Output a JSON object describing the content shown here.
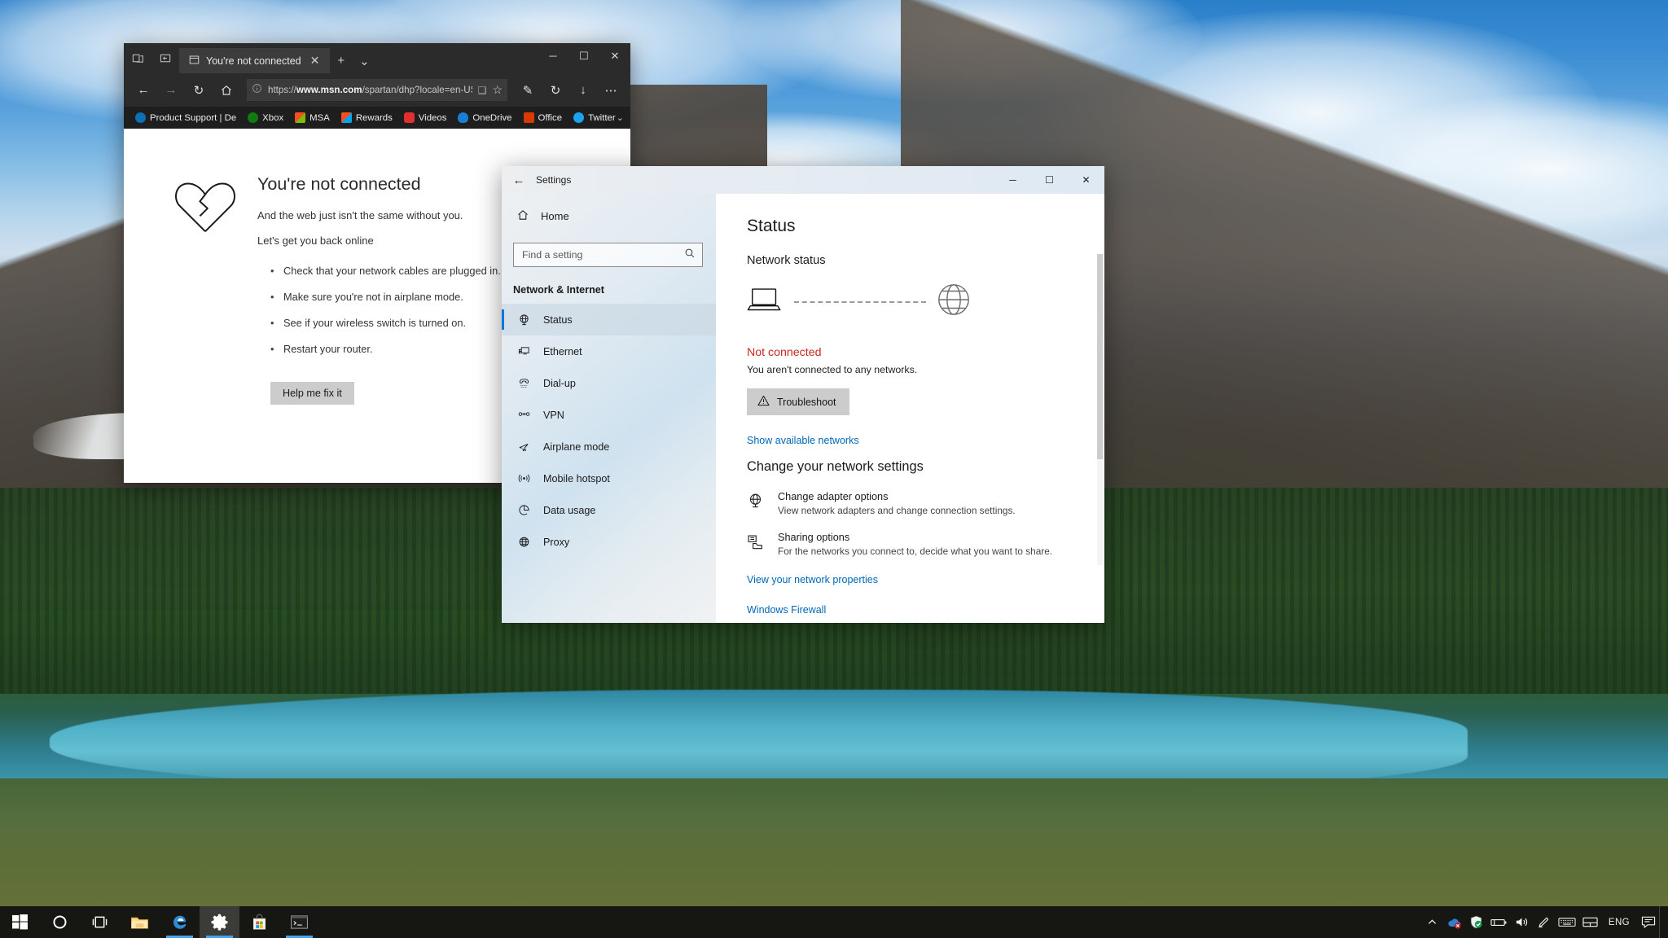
{
  "desktop": {
    "wallpaper_name": "glacier-lake-mountain-wallpaper"
  },
  "edge": {
    "window_title": "You're not connected",
    "titlebar_icons": [
      {
        "name": "set-tabs-aside-icon",
        "glyph": "⧉"
      },
      {
        "name": "tabs-you-set-aside-icon",
        "glyph": "❐"
      }
    ],
    "tab": {
      "icon": "page-icon",
      "title": "You're not connected",
      "close": "✕"
    },
    "new_tab_label": "+",
    "tab_menu_label": "⌄",
    "window_controls": {
      "minimize": "─",
      "maximize": "☐",
      "close": "✕"
    },
    "nav": {
      "back": "←",
      "forward": "→",
      "refresh": "↻",
      "home": "⌂"
    },
    "address": {
      "info_icon": "ⓘ",
      "url_prefix": "https://",
      "url_domain": "www.msn.com",
      "url_path": "/spartan/dhp?locale=en-US&",
      "reading_view_icon": "❑",
      "favorite_icon": "☆"
    },
    "toolbar_right": {
      "notes": "✎",
      "history": "↻",
      "downloads": "↓",
      "more": "⋯"
    },
    "favorites": [
      {
        "label": "Product Support | Dе",
        "icon": "dell-icon",
        "color": "#0f6fb5"
      },
      {
        "label": "Xbox",
        "icon": "xbox-icon",
        "color": "#107c10"
      },
      {
        "label": "MSA",
        "icon": "microsoft-icon",
        "color": "#f25022"
      },
      {
        "label": "Rewards",
        "icon": "microsoft-icon",
        "color": "#f25022"
      },
      {
        "label": "Videos",
        "icon": "youtube-icon",
        "color": "#e02f2f"
      },
      {
        "label": "OneDrive",
        "icon": "onedrive-icon",
        "color": "#1a7fd4"
      },
      {
        "label": "Office",
        "icon": "office-icon",
        "color": "#d83b01"
      },
      {
        "label": "Twitter",
        "icon": "twitter-icon",
        "color": "#1da1f2"
      }
    ],
    "favbar_overflow": "⌄",
    "error_page": {
      "icon": "broken-heart-icon",
      "heading": "You're not connected",
      "subheading": "And the web just isn't the same without you.",
      "lead": "Let's get you back online",
      "tips": [
        "Check that your network cables are plugged in.",
        "Make sure you're not in airplane mode.",
        "See if your wireless switch is turned on.",
        "Restart your router."
      ],
      "button_label": "Help me fix it"
    }
  },
  "settings": {
    "titlebar": {
      "back": "←",
      "title": "Settings"
    },
    "window_controls": {
      "minimize": "─",
      "maximize": "☐",
      "close": "✕"
    },
    "nav": {
      "home_label": "Home",
      "search_placeholder": "Find a setting",
      "search_value": "",
      "search_icon": "search-icon",
      "category": "Network & Internet",
      "items": [
        {
          "label": "Status",
          "icon": "globe-network-icon",
          "active": true
        },
        {
          "label": "Ethernet",
          "icon": "ethernet-icon",
          "active": false
        },
        {
          "label": "Dial-up",
          "icon": "dialup-phone-icon",
          "active": false
        },
        {
          "label": "VPN",
          "icon": "vpn-icon",
          "active": false
        },
        {
          "label": "Airplane mode",
          "icon": "airplane-icon",
          "active": false
        },
        {
          "label": "Mobile hotspot",
          "icon": "hotspot-icon",
          "active": false
        },
        {
          "label": "Data usage",
          "icon": "pie-chart-icon",
          "active": false
        },
        {
          "label": "Proxy",
          "icon": "globe-icon",
          "active": false
        }
      ]
    },
    "main": {
      "page_title": "Status",
      "section_title": "Network status",
      "diagram": {
        "device_icon": "laptop-icon",
        "link_icon": "dashed-line-icon",
        "internet_icon": "globe-icon"
      },
      "status_label": "Not connected",
      "status_color": "#c42b1c",
      "status_description": "You aren't connected to any networks.",
      "troubleshoot_button": "Troubleshoot",
      "troubleshoot_icon": "warning-triangle-icon",
      "show_networks_link": "Show available networks",
      "change_settings_title": "Change your network settings",
      "options": [
        {
          "icon": "adapter-globe-icon",
          "title": "Change adapter options",
          "desc": "View network adapters and change connection settings."
        },
        {
          "icon": "sharing-folder-icon",
          "title": "Sharing options",
          "desc": "For the networks you connect to, decide what you want to share."
        }
      ],
      "links": [
        {
          "label": "View your network properties"
        },
        {
          "label": "Windows Firewall"
        }
      ],
      "link_color": "#0067b8"
    }
  },
  "taskbar": {
    "items": [
      {
        "name": "start-button",
        "icon": "windows-logo-icon",
        "active": false,
        "running": false
      },
      {
        "name": "cortana-button",
        "icon": "cortana-circle-icon",
        "active": false,
        "running": false
      },
      {
        "name": "task-view-button",
        "icon": "task-view-icon",
        "active": false,
        "running": false
      },
      {
        "name": "file-explorer-button",
        "icon": "folder-icon",
        "active": false,
        "running": false
      },
      {
        "name": "edge-button",
        "icon": "edge-icon",
        "active": false,
        "running": true
      },
      {
        "name": "settings-button",
        "icon": "gear-icon",
        "active": true,
        "running": true
      },
      {
        "name": "store-button",
        "icon": "store-bag-icon",
        "active": false,
        "running": false
      },
      {
        "name": "terminal-button",
        "icon": "command-prompt-icon",
        "active": false,
        "running": true
      }
    ],
    "tray": [
      {
        "name": "show-hidden-icons-button",
        "icon": "chevron-up-icon"
      },
      {
        "name": "onedrive-tray-icon",
        "icon": "onedrive-error-icon"
      },
      {
        "name": "windows-defender-tray-icon",
        "icon": "shield-check-icon"
      },
      {
        "name": "battery-tray-icon",
        "icon": "battery-icon"
      },
      {
        "name": "volume-tray-icon",
        "icon": "speaker-icon"
      },
      {
        "name": "pen-workspace-tray-icon",
        "icon": "pen-icon"
      },
      {
        "name": "touch-keyboard-tray-icon",
        "icon": "keyboard-icon"
      },
      {
        "name": "touchpad-tray-icon",
        "icon": "touchpad-icon"
      }
    ],
    "language": "ENG",
    "action_center_icon": "notifications-icon"
  }
}
